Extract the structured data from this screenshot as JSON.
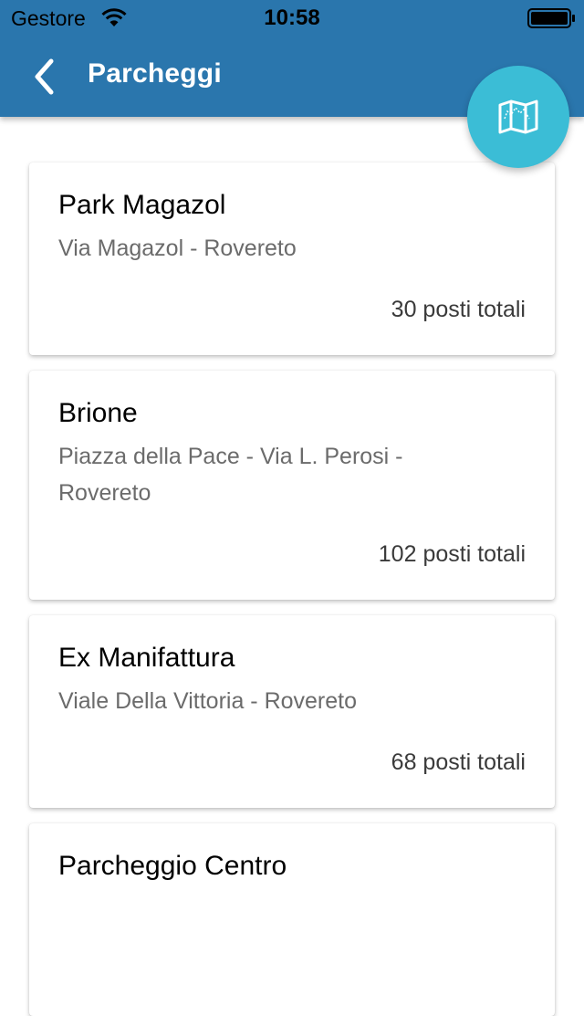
{
  "status_bar": {
    "carrier": "Gestore",
    "time": "10:58"
  },
  "nav": {
    "title": "Parcheggi",
    "back_icon": "chevron-left-icon",
    "map_button_icon": "map-icon"
  },
  "colors": {
    "header": "#2a76ad",
    "fab": "#3bbdd6"
  },
  "parkings": [
    {
      "name": "Park Magazol",
      "address": "Via Magazol - Rovereto",
      "capacity": "30 posti totali"
    },
    {
      "name": "Brione",
      "address": "Piazza della Pace - Via L. Perosi - Rovereto",
      "capacity": "102 posti totali"
    },
    {
      "name": "Ex Manifattura",
      "address": "Viale Della Vittoria - Rovereto",
      "capacity": "68 posti totali"
    },
    {
      "name": "Parcheggio Centro",
      "address": "",
      "capacity": ""
    }
  ]
}
